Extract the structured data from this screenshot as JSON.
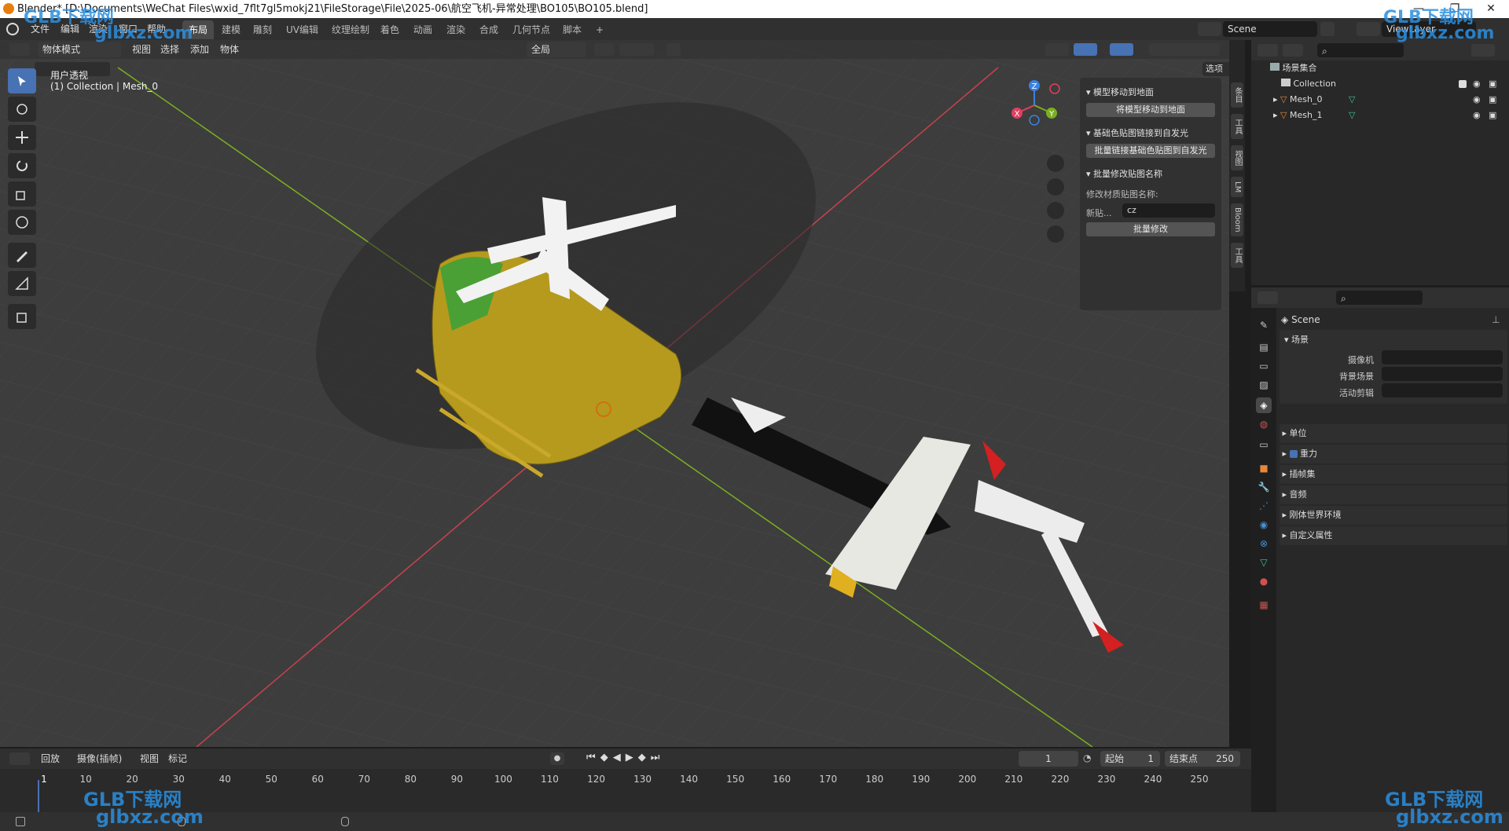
{
  "window": {
    "title": "Blender* [D:\\Documents\\WeChat Files\\wxid_7flt7gl5mokj21\\FileStorage\\File\\2025-06\\航空飞机-异常处理\\BO105\\BO105.blend]",
    "minimize": "—",
    "maximize": "❐",
    "close": "✕"
  },
  "menubar": {
    "menus": [
      "文件",
      "编辑",
      "渲染",
      "窗口",
      "帮助"
    ],
    "workspaces": [
      "布局",
      "建模",
      "雕刻",
      "UV编辑",
      "纹理绘制",
      "着色",
      "动画",
      "渲染",
      "合成",
      "几何节点",
      "脚本"
    ],
    "active_workspace": "布局",
    "add_tab": "+",
    "scene_name": "Scene",
    "view_layer": "ViewLayer"
  },
  "viewport": {
    "mode": "物体模式",
    "menus": [
      "视图",
      "选择",
      "添加",
      "物体"
    ],
    "transform_orientation": "全局",
    "options_label": "选项",
    "view_label": "用户透视",
    "collection_label": "(1) Collection | Mesh_0",
    "gizmo_axes": [
      "Z",
      "Y",
      "X"
    ],
    "tools": [
      "select-box",
      "cursor",
      "move",
      "rotate",
      "scale",
      "transform",
      "annotate",
      "measure",
      "add-cube"
    ]
  },
  "npanel": {
    "sections": [
      {
        "title": "模型移动到地面",
        "button": "将模型移动到地面"
      },
      {
        "title": "基础色贴图链接到自发光",
        "button": "批量链接基础色贴图到自发光"
      },
      {
        "title": "批量修改贴图名称",
        "field_caption": "修改材质贴图名称:",
        "field_label": "新贴...",
        "field_value": "cz",
        "button": "批量修改"
      }
    ],
    "side_tabs": [
      "条目",
      "工具",
      "视图",
      "LM",
      "Bloom",
      "工具"
    ]
  },
  "outliner": {
    "rows": [
      {
        "label": "场景集合",
        "type": "scene-collection"
      },
      {
        "label": "Collection",
        "type": "collection"
      },
      {
        "label": "Mesh_0",
        "type": "mesh"
      },
      {
        "label": "Mesh_1",
        "type": "mesh"
      }
    ]
  },
  "properties": {
    "scene_name": "Scene",
    "panel_title": "场景",
    "fields": [
      {
        "label": "摄像机",
        "value": ""
      },
      {
        "label": "背景场景",
        "value": ""
      },
      {
        "label": "活动剪辑",
        "value": ""
      }
    ],
    "sections": [
      "单位",
      "重力",
      "插帧集",
      "音频",
      "刚体世界环境",
      "自定义属性"
    ]
  },
  "timeline": {
    "menus": [
      "回放",
      "摄像(插帧)",
      "视图",
      "标记"
    ],
    "current_frame": "1",
    "start_label": "起始",
    "start_value": "1",
    "end_label": "结束点",
    "end_value": "250",
    "ticks": [
      "1",
      "10",
      "20",
      "30",
      "40",
      "50",
      "60",
      "70",
      "80",
      "90",
      "100",
      "110",
      "120",
      "130",
      "140",
      "150",
      "160",
      "170",
      "180",
      "190",
      "200",
      "210",
      "220",
      "230",
      "240",
      "250"
    ]
  },
  "watermarks": {
    "brand": "GLB下载网",
    "domain": "glbxz.com"
  },
  "colors": {
    "accent": "#4772b3",
    "axis_x": "#e04060",
    "axis_y": "#7ab020",
    "axis_z": "#3b82e0",
    "body": "#b59a1e"
  }
}
